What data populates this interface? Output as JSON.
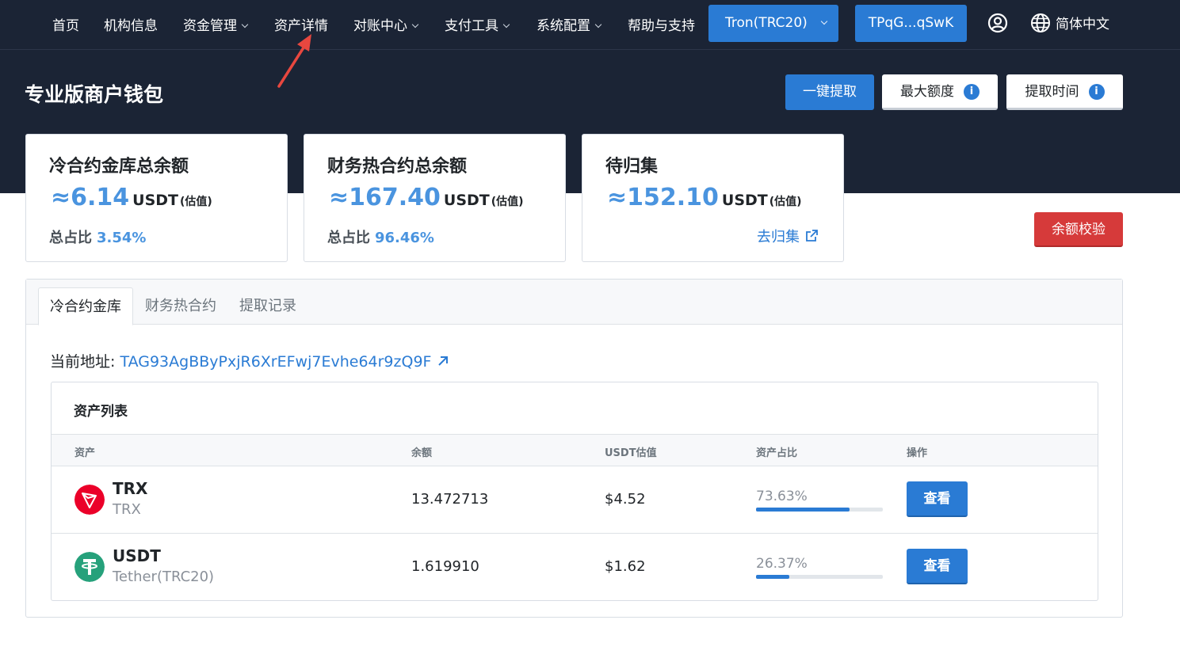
{
  "nav": {
    "items": [
      {
        "label": "首页",
        "dropdown": false
      },
      {
        "label": "机构信息",
        "dropdown": false
      },
      {
        "label": "资金管理",
        "dropdown": true
      },
      {
        "label": "资产详情",
        "dropdown": false
      },
      {
        "label": "对账中心",
        "dropdown": true
      },
      {
        "label": "支付工具",
        "dropdown": true
      },
      {
        "label": "系统配置",
        "dropdown": true
      },
      {
        "label": "帮助与支持",
        "dropdown": false
      }
    ],
    "network": "Tron(TRC20)",
    "wallet_address": "TPqG...qSwK",
    "language": "简体中文",
    "icons": [
      "user-circle-icon",
      "globe-icon",
      "chevron-down-icon"
    ]
  },
  "header": {
    "title": "专业版商户钱包",
    "withdraw_all": "一键提取",
    "max_limit": "最大额度",
    "withdraw_time": "提取时间",
    "info_glyph": "i"
  },
  "cards": [
    {
      "title": "冷合约金库总余额",
      "amount": "≈6.14",
      "unit": "USDT",
      "estimate": "(估值)",
      "ratio_label": "总占比",
      "ratio_value": "3.54%"
    },
    {
      "title": "财务热合约总余额",
      "amount": "≈167.40",
      "unit": "USDT",
      "estimate": "(估值)",
      "ratio_label": "总占比",
      "ratio_value": "96.46%"
    },
    {
      "title": "待归集",
      "amount": "≈152.10",
      "unit": "USDT",
      "estimate": "(估值)",
      "link": "去归集"
    }
  ],
  "balance_check": "余额校验",
  "tabs": [
    "冷合约金库",
    "财务热合约",
    "提取记录"
  ],
  "current_address": {
    "label": "当前地址:",
    "value": "TAG93AgBByPxjR6XrEFwj7Evhe64r9zQ9F"
  },
  "asset_list": {
    "title": "资产列表",
    "columns": [
      "资产",
      "余额",
      "USDT估值",
      "资产占比",
      "操作"
    ],
    "rows": [
      {
        "symbol": "TRX",
        "name": "TRX",
        "balance": "13.472713",
        "usdt_value": "$4.52",
        "share": "73.63%",
        "share_fraction": 0.7363,
        "action": "查看",
        "icon": "tron-icon",
        "icon_color": "#eb0029"
      },
      {
        "symbol": "USDT",
        "name": "Tether(TRC20)",
        "balance": "1.619910",
        "usdt_value": "$1.62",
        "share": "26.37%",
        "share_fraction": 0.2637,
        "action": "查看",
        "icon": "tether-icon",
        "icon_color": "#26a17b"
      }
    ]
  },
  "colors": {
    "hero_bg": "#1b2435",
    "primary": "#2a7bd4",
    "accent_text": "#4a94df",
    "danger": "#d63a3a",
    "annotation_arrow": "#e8473f"
  }
}
